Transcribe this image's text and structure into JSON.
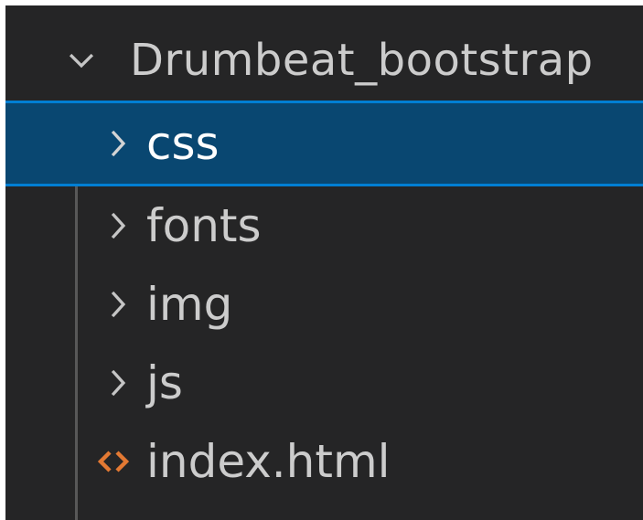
{
  "explorer": {
    "root": {
      "label": "Drumbeat_bootstrap",
      "icon": "chevron-down-icon",
      "expanded": true
    },
    "items": [
      {
        "label": "css",
        "type": "folder",
        "icon": "chevron-right-icon",
        "selected": true
      },
      {
        "label": "fonts",
        "type": "folder",
        "icon": "chevron-right-icon",
        "selected": false
      },
      {
        "label": "img",
        "type": "folder",
        "icon": "chevron-right-icon",
        "selected": false
      },
      {
        "label": "js",
        "type": "folder",
        "icon": "chevron-right-icon",
        "selected": false
      },
      {
        "label": "index.html",
        "type": "file",
        "icon": "html-file-icon",
        "selected": false
      }
    ]
  },
  "colors": {
    "background": "#252526",
    "selection": "#094771",
    "selection_border": "#007fd4",
    "text": "#cccccc",
    "html_icon": "#e37933"
  }
}
